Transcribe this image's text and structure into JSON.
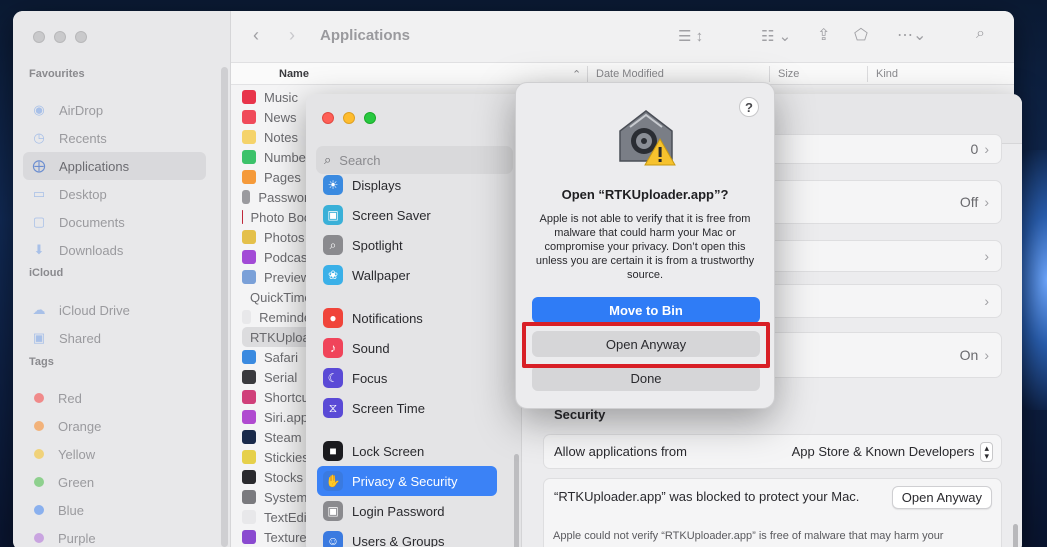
{
  "finder": {
    "title": "Applications",
    "sidebar": {
      "favourites_label": "Favourites",
      "favourites": [
        {
          "label": "AirDrop",
          "icon": "airdrop-icon"
        },
        {
          "label": "Recents",
          "icon": "clock-icon"
        },
        {
          "label": "Applications",
          "icon": "applications-icon",
          "active": true
        },
        {
          "label": "Desktop",
          "icon": "desktop-icon"
        },
        {
          "label": "Documents",
          "icon": "document-icon"
        },
        {
          "label": "Downloads",
          "icon": "download-icon"
        }
      ],
      "icloud_label": "iCloud",
      "icloud": [
        {
          "label": "iCloud Drive",
          "icon": "cloud-icon"
        },
        {
          "label": "Shared",
          "icon": "shared-folder-icon"
        }
      ],
      "tags_label": "Tags",
      "tags": [
        {
          "label": "Red",
          "color": "#f08a8a"
        },
        {
          "label": "Orange",
          "color": "#f2b27a"
        },
        {
          "label": "Yellow",
          "color": "#f0d27a"
        },
        {
          "label": "Green",
          "color": "#8ed08e"
        },
        {
          "label": "Blue",
          "color": "#8ab0ee"
        },
        {
          "label": "Purple",
          "color": "#c9a4e0"
        }
      ]
    },
    "columns": {
      "name": "Name",
      "date": "Date Modified",
      "size": "Size",
      "kind": "Kind"
    },
    "files": [
      {
        "label": "Music",
        "color": "#e8344a"
      },
      {
        "label": "News",
        "color": "#f04a5a"
      },
      {
        "label": "Notes",
        "color": "#f5d36a"
      },
      {
        "label": "Numbers",
        "color": "#3cc26a"
      },
      {
        "label": "Pages",
        "color": "#f59a3a"
      },
      {
        "label": "Passwords",
        "color": "#9a9a9e"
      },
      {
        "label": "Photo Booth",
        "color": "#c0283a"
      },
      {
        "label": "Photos",
        "color": "#e4c04a"
      },
      {
        "label": "Podcasts",
        "color": "#a24ad6"
      },
      {
        "label": "Preview",
        "color": "#7aa0d8"
      },
      {
        "label": "QuickTime Player",
        "color": "#2a4a8a"
      },
      {
        "label": "Reminders",
        "color": "#e8e8ea"
      },
      {
        "label": "RTKUploader",
        "color": "#d0d0d2",
        "selected": true
      },
      {
        "label": "Safari",
        "color": "#3a8ae0"
      },
      {
        "label": "Serial",
        "color": "#3a3a3e"
      },
      {
        "label": "Shortcuts",
        "color": "#d0407a"
      },
      {
        "label": "Siri.app",
        "color": "#b04ad0"
      },
      {
        "label": "Steam",
        "color": "#1a2a4a"
      },
      {
        "label": "Stickies",
        "color": "#e6d04a"
      },
      {
        "label": "Stocks",
        "color": "#2a2a2e"
      },
      {
        "label": "System",
        "color": "#7a7a7e"
      },
      {
        "label": "TextEdit",
        "color": "#e8e8ea"
      },
      {
        "label": "Texture",
        "color": "#8a4ad0"
      }
    ]
  },
  "settings": {
    "search_placeholder": "Search",
    "items": [
      {
        "label": "Displays",
        "icon": "displays-icon",
        "color": "#3a8ae0"
      },
      {
        "label": "Screen Saver",
        "icon": "screen-saver-icon",
        "color": "#3ab0d8"
      },
      {
        "label": "Spotlight",
        "icon": "spotlight-icon",
        "color": "#8a8a8e"
      },
      {
        "label": "Wallpaper",
        "icon": "wallpaper-icon",
        "color": "#3ab0e8"
      },
      {
        "label": "Notifications",
        "icon": "notifications-icon",
        "color": "#f0443a"
      },
      {
        "label": "Sound",
        "icon": "sound-icon",
        "color": "#f0445a"
      },
      {
        "label": "Focus",
        "icon": "focus-icon",
        "color": "#5a4ad6"
      },
      {
        "label": "Screen Time",
        "icon": "screen-time-icon",
        "color": "#5a4ad6"
      },
      {
        "label": "Lock Screen",
        "icon": "lock-screen-icon",
        "color": "#1a1a1e"
      },
      {
        "label": "Privacy & Security",
        "icon": "privacy-hand-icon",
        "color": "#3a7ae0",
        "active": true
      },
      {
        "label": "Login Password",
        "icon": "login-password-icon",
        "color": "#8a8a8e"
      },
      {
        "label": "Users & Groups",
        "icon": "users-groups-icon",
        "color": "#3a7ae0"
      }
    ],
    "rows": [
      {
        "value": "0"
      },
      {
        "value": "Off"
      },
      {
        "value": ""
      },
      {
        "value": ""
      },
      {
        "value": "On"
      }
    ],
    "security_title": "Security",
    "allow_label": "Allow applications from",
    "allow_value": "App Store & Known Developers",
    "blocked_text": "“RTKUploader.app” was blocked to protect your Mac.",
    "blocked_button": "Open Anyway",
    "note_text": "Apple could not verify “RTKUploader.app” is free of malware that may harm your"
  },
  "alert": {
    "help": "?",
    "title": "Open “RTKUploader.app”?",
    "message": "Apple is not able to verify that it is free from malware that could harm your Mac or compromise your privacy. Don’t open this unless you are certain it is from a trustworthy source.",
    "primary": "Move to Bin",
    "secondary": "Open Anyway",
    "tertiary": "Done",
    "highlight_color": "#d81f26"
  }
}
